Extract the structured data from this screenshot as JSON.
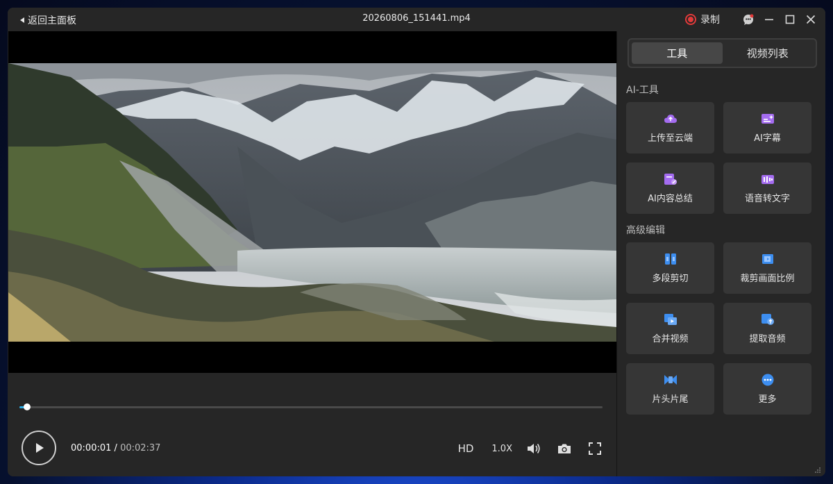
{
  "titlebar": {
    "back_label": "返回主面板",
    "file_name": "20260806_151441.mp4",
    "record_label": "录制"
  },
  "player": {
    "current_time": "00:00:01",
    "separator": "/",
    "total_time": "00:02:37",
    "progress_fraction": 0.013,
    "quality_label": "HD",
    "speed_label": "1.0X"
  },
  "sidebar": {
    "tabs": [
      {
        "label": "工具",
        "active": true
      },
      {
        "label": "视频列表",
        "active": false
      }
    ],
    "ai_section_title": "AI-工具",
    "ai_tools": [
      {
        "label": "上传至云端",
        "icon": "cloud-upload-icon",
        "color": "#a46cf0"
      },
      {
        "label": "AI字幕",
        "icon": "ai-subtitle-icon",
        "color": "#a46cf0"
      },
      {
        "label": "AI内容总结",
        "icon": "ai-summary-icon",
        "color": "#a46cf0"
      },
      {
        "label": "语音转文字",
        "icon": "speech-to-text-icon",
        "color": "#a46cf0"
      }
    ],
    "edit_section_title": "高级编辑",
    "edit_tools": [
      {
        "label": "多段剪切",
        "icon": "multi-cut-icon",
        "color": "#3d8ef0"
      },
      {
        "label": "裁剪画面比例",
        "icon": "crop-ratio-icon",
        "color": "#3d8ef0"
      },
      {
        "label": "合并视频",
        "icon": "merge-video-icon",
        "color": "#3d8ef0"
      },
      {
        "label": "提取音频",
        "icon": "extract-audio-icon",
        "color": "#3d8ef0"
      },
      {
        "label": "片头片尾",
        "icon": "intro-outro-icon",
        "color": "#3d8ef0"
      },
      {
        "label": "更多",
        "icon": "more-icon",
        "color": "#3d8ef0"
      }
    ]
  },
  "colors": {
    "accent": "#29a9e1",
    "record": "#e23a3a",
    "ai_purple": "#a46cf0",
    "edit_blue": "#3d8ef0"
  }
}
